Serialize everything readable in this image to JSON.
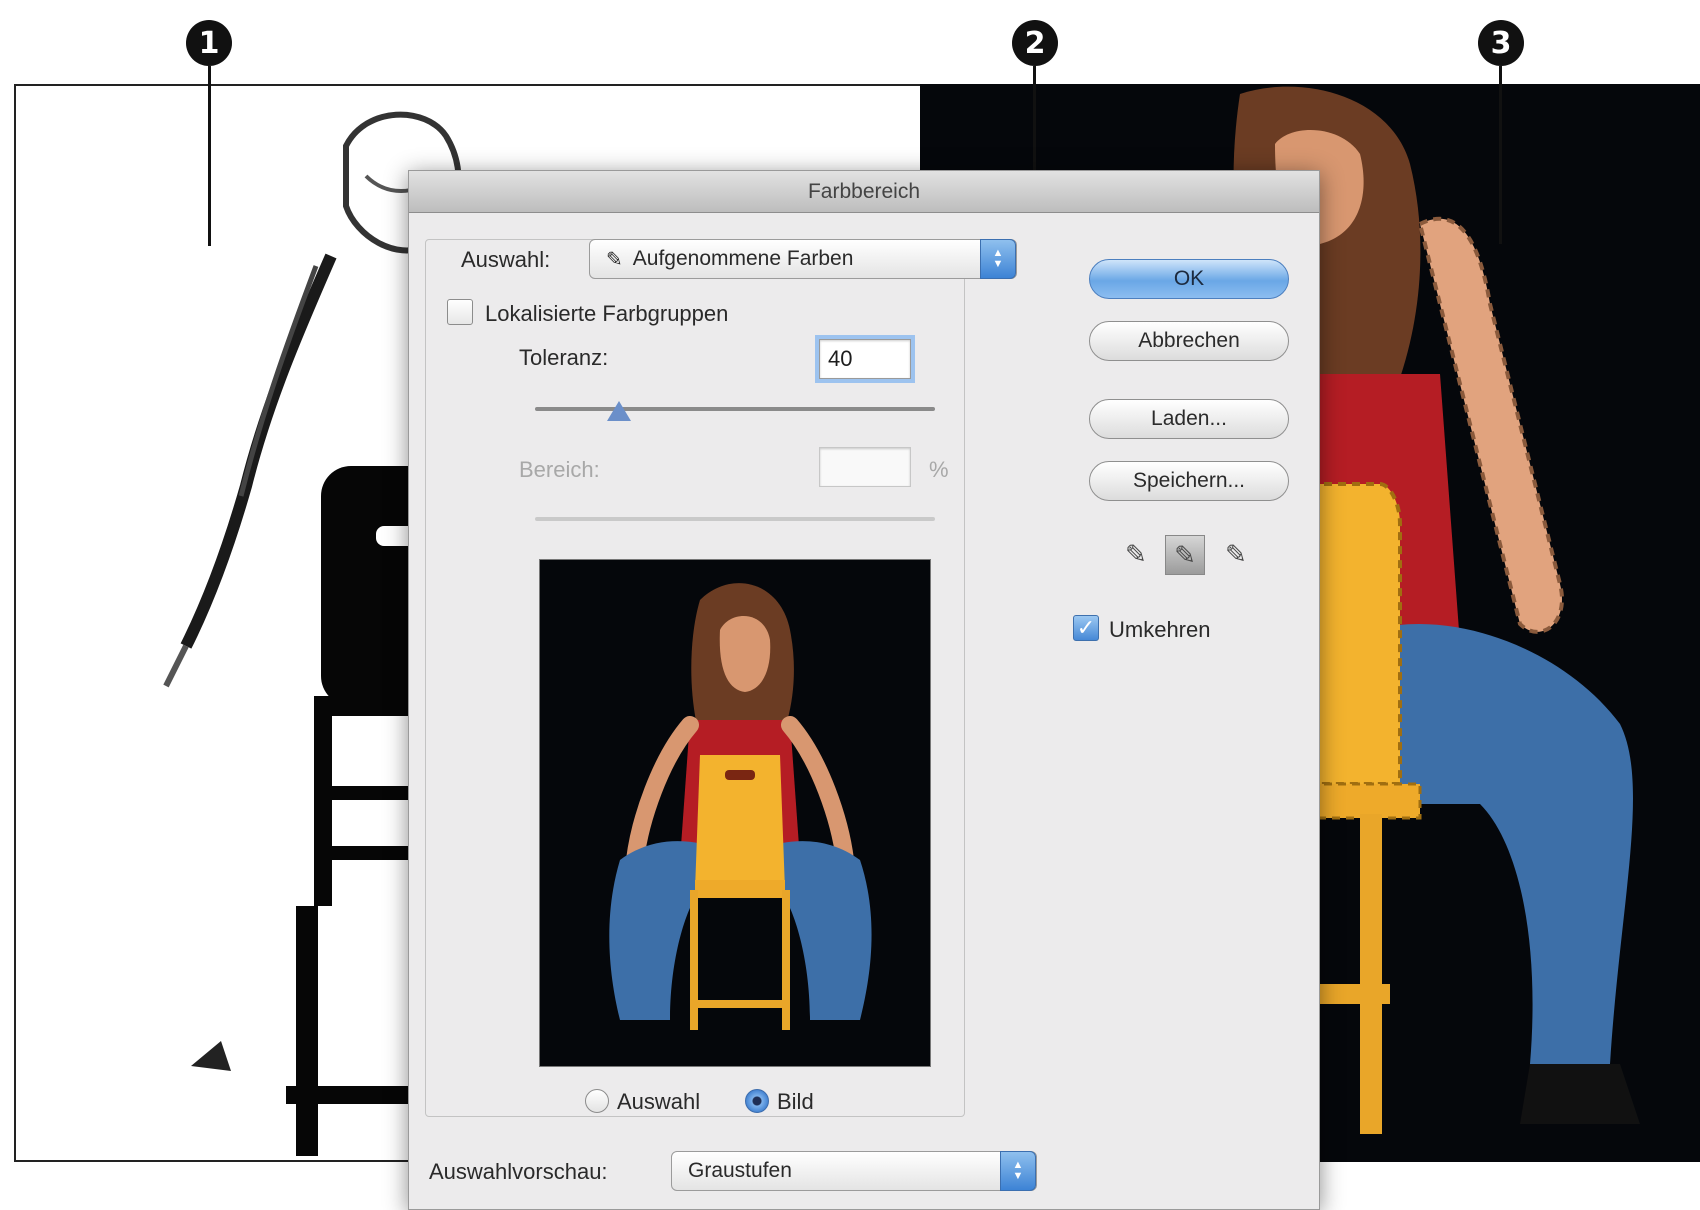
{
  "callouts": [
    "1",
    "2",
    "3"
  ],
  "dialog": {
    "title": "Farbbereich",
    "select_label": "Auswahl:",
    "select_value": "Aufgenommene Farben",
    "localized_label": "Lokalisierte Farbgruppen",
    "localized_checked": false,
    "tolerance_label": "Toleranz:",
    "tolerance_value": "40",
    "tolerance_fraction": 0.21,
    "range_label": "Bereich:",
    "range_value": "",
    "range_unit": "%",
    "buttons": {
      "ok": "OK",
      "cancel": "Abbrechen",
      "load": "Laden...",
      "save": "Speichern..."
    },
    "invert_label": "Umkehren",
    "invert_checked": true,
    "preview_options": [
      "Auswahl",
      "Bild"
    ],
    "preview_selected": "Bild",
    "selection_preview_label": "Auswahlvorschau:",
    "selection_preview_value": "Graustufen"
  },
  "icons": {
    "eyedropper": "eyedropper-icon",
    "eyedropper_add": "eyedropper-plus-icon",
    "eyedropper_subtract": "eyedropper-minus-icon",
    "popup_stepper": "up-down-arrows-icon"
  },
  "colors": {
    "accent_blue": "#4a8ad8",
    "shirt_red": "#b51d24",
    "chair_yellow": "#f3b32e",
    "jeans_blue": "#3d6fa8",
    "background_black": "#05070b"
  }
}
